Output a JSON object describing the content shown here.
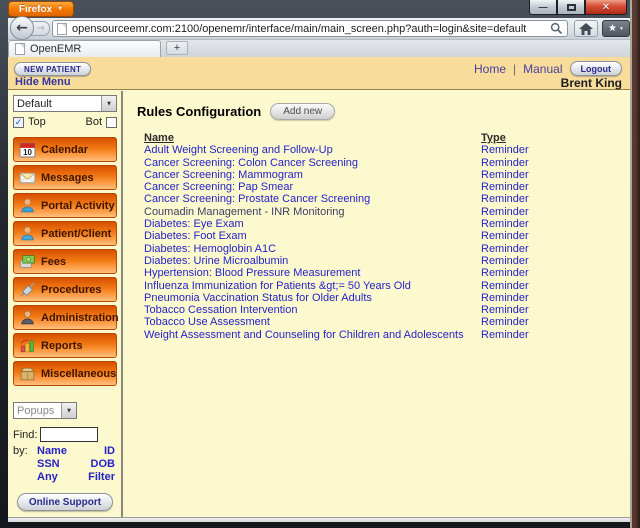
{
  "browser": {
    "firefox_button_label": "Firefox",
    "url": "opensourceemr.com:2100/openemr/interface/main/main_screen.php?auth=login&site=default",
    "tab_title": "OpenEMR",
    "new_tab_label": "+",
    "window_controls": [
      "minimize-icon",
      "maximize-icon",
      "close-icon"
    ]
  },
  "glyphs": {
    "dropdown_caret": "▼",
    "back_arrow": "←",
    "forward_arrow": "→",
    "minimize": "—",
    "close": "✕",
    "star": "★",
    "check": "✓"
  },
  "header": {
    "new_patient_label": "NEW PATIENT",
    "hide_menu_label": "Hide Menu",
    "home_label": "Home",
    "separator": "|",
    "manual_label": "Manual",
    "logout_label": "Logout",
    "user_name": "Brent King"
  },
  "sidebar": {
    "category_select_value": "Default",
    "top_label": "Top",
    "bot_label": "Bot",
    "menu": [
      {
        "label": "Calendar",
        "icon": "calendar-icon"
      },
      {
        "label": "Messages",
        "icon": "messages-icon"
      },
      {
        "label": "Portal Activity",
        "icon": "portal-activity-icon"
      },
      {
        "label": "Patient/Client",
        "icon": "patient-client-icon"
      },
      {
        "label": "Fees",
        "icon": "fees-icon"
      },
      {
        "label": "Procedures",
        "icon": "procedures-icon"
      },
      {
        "label": "Administration",
        "icon": "administration-icon"
      },
      {
        "label": "Reports",
        "icon": "reports-icon"
      },
      {
        "label": "Miscellaneous",
        "icon": "miscellaneous-icon"
      }
    ],
    "popups_select_value": "Popups",
    "find_label": "Find:",
    "find_value": "",
    "by_label": "by:",
    "search_links": [
      "Name",
      "ID",
      "SSN",
      "DOB",
      "Any",
      "Filter"
    ],
    "online_support_label": "Online Support"
  },
  "main": {
    "title": "Rules Configuration",
    "add_new_label": "Add new",
    "table": {
      "columns": [
        "Name",
        "Type"
      ],
      "rows": [
        {
          "name": "Adult Weight Screening and Follow-Up",
          "type": "Reminder"
        },
        {
          "name": "Cancer Screening: Colon Cancer Screening",
          "type": "Reminder"
        },
        {
          "name": "Cancer Screening: Mammogram",
          "type": "Reminder"
        },
        {
          "name": "Cancer Screening: Pap Smear",
          "type": "Reminder"
        },
        {
          "name": "Cancer Screening: Prostate Cancer Screening",
          "type": "Reminder"
        },
        {
          "name": "Coumadin Management - INR Monitoring",
          "type": "Reminder"
        },
        {
          "name": "Diabetes: Eye Exam",
          "type": "Reminder"
        },
        {
          "name": "Diabetes: Foot Exam",
          "type": "Reminder"
        },
        {
          "name": "Diabetes: Hemoglobin A1C",
          "type": "Reminder"
        },
        {
          "name": "Diabetes: Urine Microalbumin",
          "type": "Reminder"
        },
        {
          "name": "Hypertension: Blood Pressure Measurement",
          "type": "Reminder"
        },
        {
          "name": "Influenza Immunization for Patients &gt;= 50 Years Old",
          "type": "Reminder"
        },
        {
          "name": "Pneumonia Vaccination Status for Older Adults",
          "type": "Reminder"
        },
        {
          "name": "Tobacco Cessation Intervention",
          "type": "Reminder"
        },
        {
          "name": "Tobacco Use Assessment",
          "type": "Reminder"
        },
        {
          "name": "Weight Assessment and Counseling for Children and Adolescents",
          "type": "Reminder"
        }
      ]
    }
  },
  "colors": {
    "firefox_orange": "#f57c00",
    "header_tan": "#f8dc9c",
    "body_yellow": "#fdf9ce",
    "menu_orange": "#f07a14",
    "link_blue": "#2323c8"
  }
}
